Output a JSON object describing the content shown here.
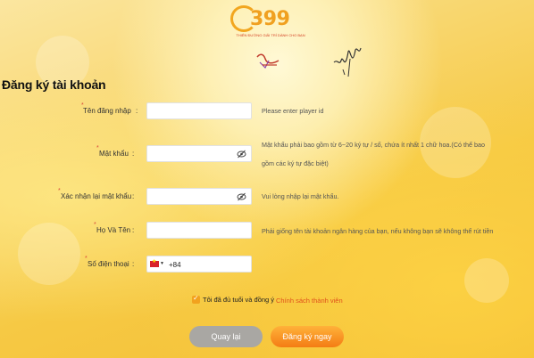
{
  "brand": {
    "logo_text": "399",
    "tagline": "THIÊN ĐƯỜNG GIẢI TRÍ DÀNH CHO BẠN"
  },
  "page_title": "Đăng ký tài khoản",
  "form": {
    "username": {
      "label": "Tên đăng nhập",
      "value": "",
      "hint": "Please enter player id"
    },
    "password": {
      "label": "Mật khẩu",
      "value": "",
      "hint_line1": "Mật khẩu phải bao gồm từ 6~20 ký tự / số, chứa ít nhất 1 chữ hoa.(Có thể bao",
      "hint_line2": "gồm các ký tự đặc biệt)"
    },
    "confirm_password": {
      "label": "Xác nhận lại mật khẩu",
      "value": "",
      "hint": "Vui lòng nhập lại mật khẩu."
    },
    "full_name": {
      "label": "Họ Và Tên",
      "value": "",
      "hint": "Phải giống tên tài khoản ngân hàng của bạn, nếu không bạn sẽ không thể rút tiền"
    },
    "phone": {
      "label": "Số điện thoại",
      "country_code": "+84",
      "value": ""
    },
    "colon": ":",
    "required_mark": "*"
  },
  "agreement": {
    "text": "Tôi đã đủ tuổi và đồng ý",
    "link": "Chính sách thành viên",
    "checked": true
  },
  "buttons": {
    "back": "Quay lại",
    "submit": "Đăng ký ngay"
  },
  "colors": {
    "accent": "#f47c14",
    "link": "#e0501c",
    "required": "#d9483b"
  }
}
